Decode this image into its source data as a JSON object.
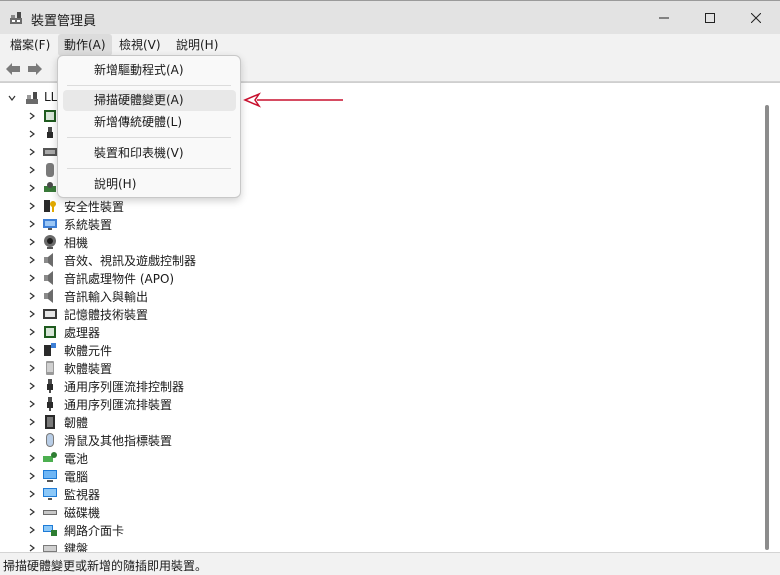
{
  "window": {
    "title": "裝置管理員"
  },
  "menubar": {
    "file": "檔案(F)",
    "action": "動作(A)",
    "view": "檢視(V)",
    "help": "說明(H)"
  },
  "dropdown": {
    "add_drivers": "新增驅動程式(A)",
    "scan_hardware": "掃描硬體變更(A)",
    "add_legacy": "新增傳統硬體(L)",
    "devices_printers": "裝置和印表機(V)",
    "help": "說明(H)"
  },
  "tree": {
    "root_label": "LL",
    "items": [
      {
        "label": "安全性裝置",
        "icon": "security-device-icon"
      },
      {
        "label": "系統裝置",
        "icon": "system-device-icon"
      },
      {
        "label": "相機",
        "icon": "camera-icon"
      },
      {
        "label": "音效、視訊及遊戲控制器",
        "icon": "speaker-icon"
      },
      {
        "label": "音訊處理物件 (APO)",
        "icon": "speaker-icon"
      },
      {
        "label": "音訊輸入與輸出",
        "icon": "speaker-icon"
      },
      {
        "label": "記憶體技術裝置",
        "icon": "memory-icon"
      },
      {
        "label": "處理器",
        "icon": "processor-icon"
      },
      {
        "label": "軟體元件",
        "icon": "software-component-icon"
      },
      {
        "label": "軟體裝置",
        "icon": "software-device-icon"
      },
      {
        "label": "通用序列匯流排控制器",
        "icon": "usb-icon"
      },
      {
        "label": "通用序列匯流排裝置",
        "icon": "usb-icon"
      },
      {
        "label": "韌體",
        "icon": "firmware-icon"
      },
      {
        "label": "滑鼠及其他指標裝置",
        "icon": "mouse-icon"
      },
      {
        "label": "電池",
        "icon": "battery-icon"
      },
      {
        "label": "電腦",
        "icon": "computer-icon"
      },
      {
        "label": "監視器",
        "icon": "monitor-icon"
      },
      {
        "label": "磁碟機",
        "icon": "disk-drive-icon"
      },
      {
        "label": "網路介面卡",
        "icon": "network-adapter-icon"
      },
      {
        "label": "鍵盤",
        "icon": "keyboard-icon"
      }
    ]
  },
  "status": {
    "text": "掃描硬體變更或新增的隨插即用裝置。"
  },
  "colors": {
    "annotation_arrow": "#c8102e",
    "accent": "#0067c0"
  }
}
